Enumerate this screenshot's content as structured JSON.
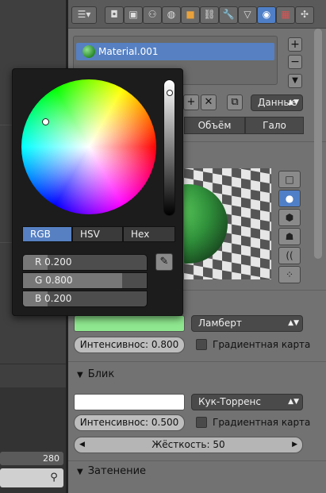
{
  "toolbar": {
    "icons": [
      "view-icon",
      "render-icon",
      "layers-icon",
      "scene-icon",
      "world-icon",
      "object-icon",
      "constraints-icon",
      "modifiers-icon",
      "data-icon",
      "material-icon",
      "texture-icon",
      "particles-icon"
    ],
    "active": "material-icon"
  },
  "material": {
    "name": "Material.001",
    "data_dropdown": "Данные"
  },
  "tabs": [
    "Объём",
    "Гало"
  ],
  "picker": {
    "modes": [
      "RGB",
      "HSV",
      "Hex"
    ],
    "active_mode": "RGB",
    "channels": [
      {
        "label": "R 0.200",
        "value": 0.2
      },
      {
        "label": "G 0.800",
        "value": 0.8
      },
      {
        "label": "B 0.200",
        "value": 0.2
      }
    ]
  },
  "diffuse": {
    "color": "#8fe88f",
    "shader": "Ламберт",
    "intensity_label": "Интенсивнос: 0.800",
    "ramp_label": "Градиентная карта"
  },
  "specular": {
    "header": "Блик",
    "color": "#ffffff",
    "shader": "Кук-Торренс",
    "intensity_label": "Интенсивнос: 0.500",
    "ramp_label": "Градиентная карта",
    "hardness_label": "Жёсткость: 50"
  },
  "shading": {
    "header": "Затенение"
  },
  "timeline": {
    "frame": "280"
  }
}
